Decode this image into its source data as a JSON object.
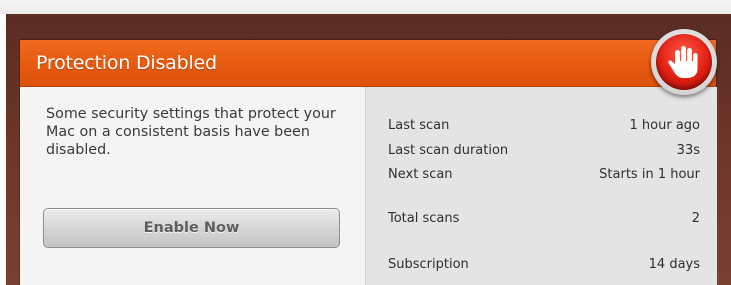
{
  "panel": {
    "title": "Protection Disabled",
    "message": "Some security settings that protect your Mac on a consistent basis have been disabled.",
    "enable_button_label": "Enable Now",
    "stats": [
      {
        "label": "Last scan",
        "value": "1 hour ago"
      },
      {
        "label": "Last scan duration",
        "value": "33s"
      },
      {
        "label": "Next scan",
        "value": "Starts in 1 hour"
      },
      {
        "label": "Total scans",
        "value": "2"
      },
      {
        "label": "Subscription",
        "value": "14 days"
      }
    ],
    "status_icon": "stop-hand-icon"
  },
  "colors": {
    "header": "#e65a0f",
    "stop_icon": "#e01e12",
    "backdrop": "#6a3428"
  }
}
